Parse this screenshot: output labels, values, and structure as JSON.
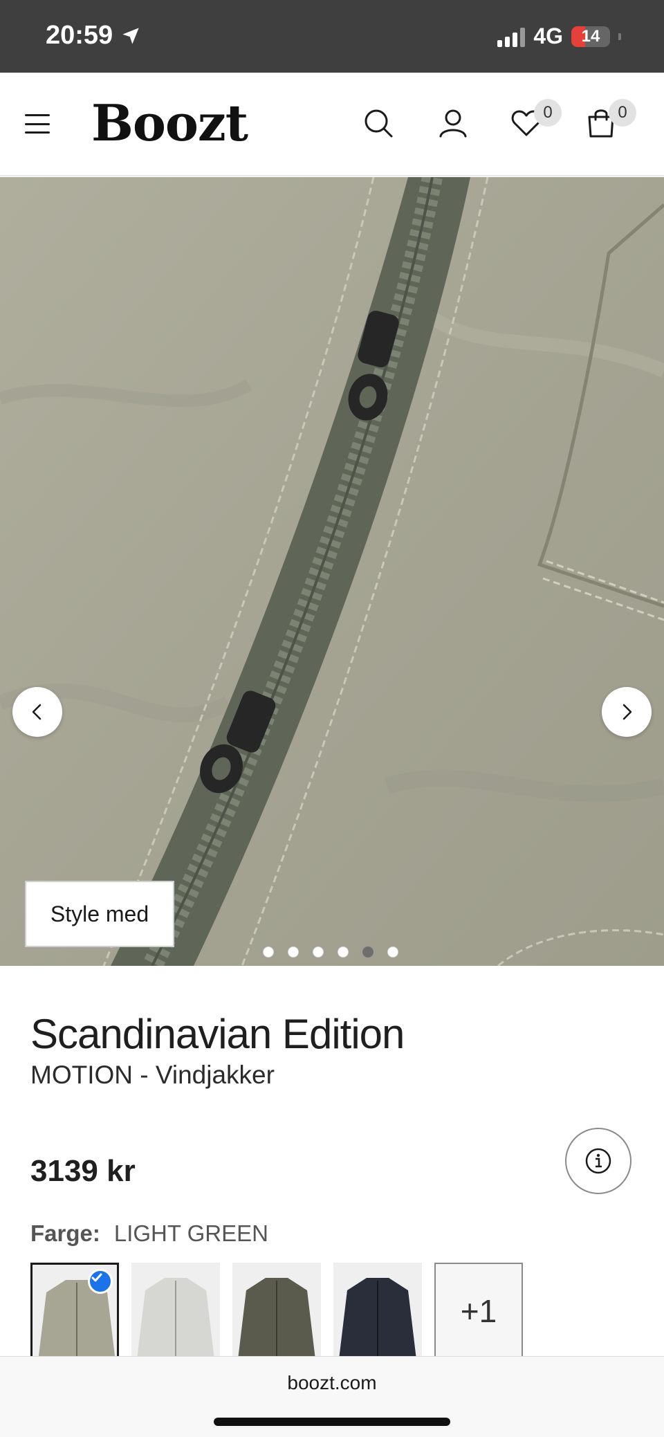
{
  "status": {
    "time": "20:59",
    "network": "4G",
    "battery": "14"
  },
  "header": {
    "logo": "Boozt",
    "wishlist_count": "0",
    "cart_count": "0"
  },
  "gallery": {
    "style_button": "Style med",
    "slide_count": 6,
    "active_slide": 5
  },
  "product": {
    "brand": "Scandinavian Edition",
    "name": "MOTION - Vindjakker",
    "price": "3139 kr",
    "color_label": "Farge:",
    "color_value": "LIGHT GREEN",
    "more_colors": "+1",
    "swatch_colors": [
      "#a7a695",
      "#d6d6d3",
      "#5a5b4c",
      "#2a2d3a"
    ]
  },
  "browser": {
    "url": "boozt.com"
  },
  "colors": {
    "status_bar": "#3f3f3f",
    "fabric": "#a7a695",
    "selected_check": "#1a73e8"
  }
}
